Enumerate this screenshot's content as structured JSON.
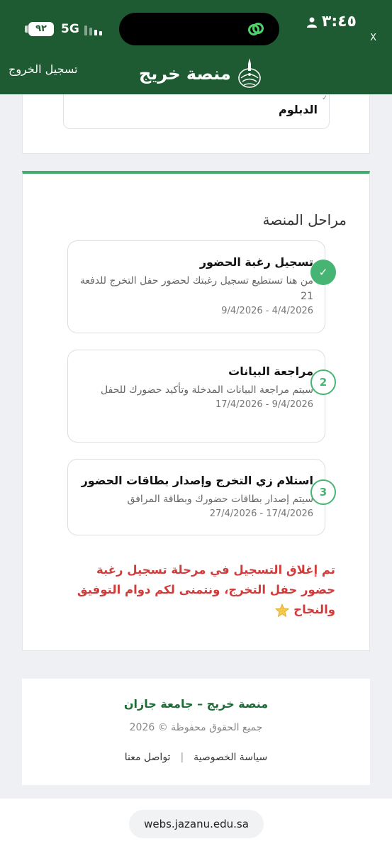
{
  "status_bar": {
    "time": "٣:٤٥",
    "network": "5G",
    "battery": "٩٢",
    "close_mark": "X"
  },
  "header": {
    "brand_name": "منصة خريج",
    "logout_label": "تسجيل الخروج",
    "logo_icon": "university-logo-icon"
  },
  "top_card": {
    "option_label": "الدبلوم"
  },
  "stages": {
    "title": "مراحل المنصة",
    "items": [
      {
        "title": "تسجيل رغبة الحضور",
        "desc": "من هنا تستطيع تسجيل رغبتك لحضور حفل التخرج للدفعة 21",
        "date": "4/4/2026 - 9/4/2026",
        "badge": "✓",
        "state": "done"
      },
      {
        "title": "مراجعة البيانات",
        "desc": "سيتم مراجعة البيانات المدخلة وتأكيد حضورك للحفل",
        "date": "9/4/2026 - 17/4/2026",
        "badge": "2",
        "state": "pending"
      },
      {
        "title": "استلام زي التخرج وإصدار بطاقات الحضور",
        "desc": "سيتم إصدار بطاقات حضورك وبطاقة المرافق",
        "date": "17/4/2026 - 27/4/2026",
        "badge": "3",
        "state": "pending"
      }
    ],
    "closed_message": "تم إغلاق التسجيل في مرحلة تسجيل رغبة حضور حفل التخرج، ونتمنى لكم دوام التوفيق والنجاح"
  },
  "footer": {
    "title": "منصة خريج – جامعة جازان",
    "copyright": "جميع الحقوق محفوظة © 2026",
    "privacy_link": "سياسة الخصوصية",
    "separator": "|",
    "contact_link": "تواصل معنا"
  },
  "browser": {
    "url": "webs.jazanu.edu.sa"
  },
  "colors": {
    "brand_green": "#1e5b32",
    "accent_green": "#46b574",
    "alert_red": "#d33b3b"
  }
}
